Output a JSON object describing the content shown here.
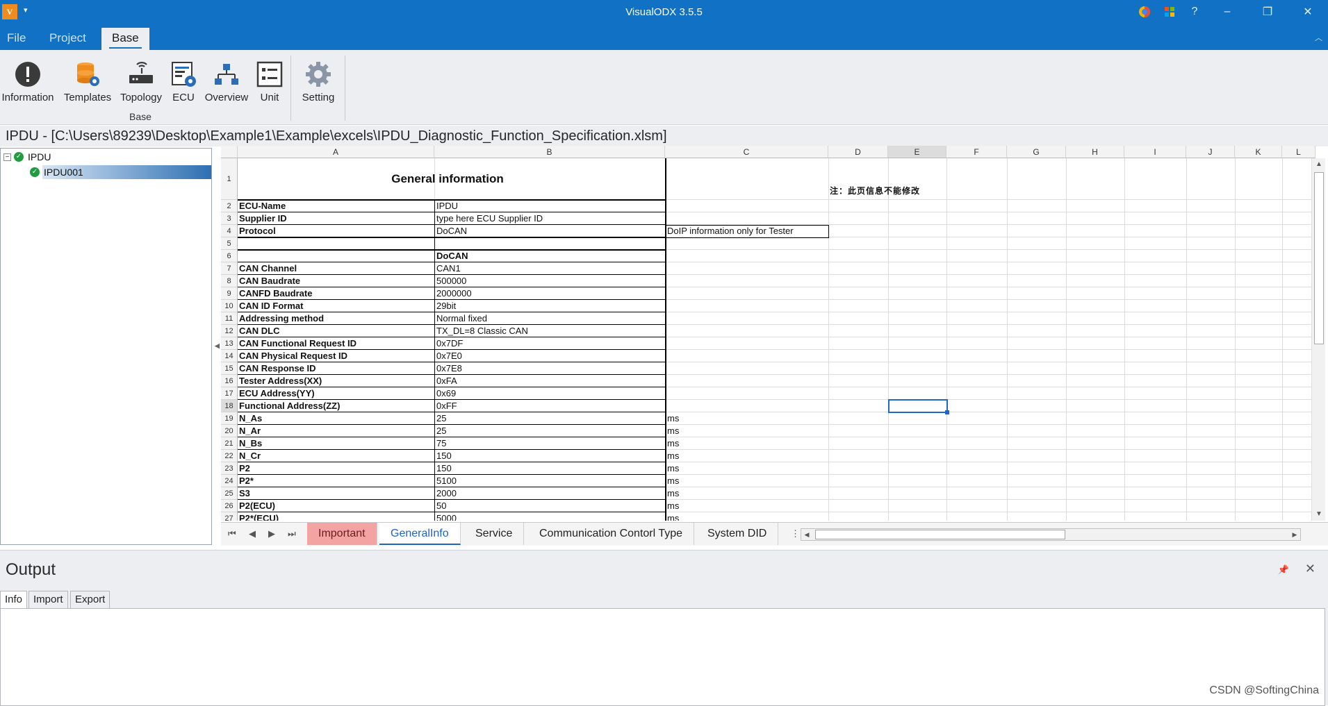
{
  "titlebar": {
    "title": "VisualODX 3.5.5",
    "app_icon_text": "V",
    "help_symbol": "?"
  },
  "menu": {
    "file": "File",
    "project": "Project",
    "base": "Base"
  },
  "ribbon": {
    "buttons": [
      "Information",
      "Templates",
      "Topology",
      "ECU",
      "Overview",
      "Unit",
      "Setting"
    ],
    "group_label": "Base"
  },
  "path": "IPDU - [C:\\Users\\89239\\Desktop\\Example1\\Example\\excels\\IPDU_Diagnostic_Function_Specification.xlsm]",
  "tree": {
    "root": "IPDU",
    "child": "IPDU001"
  },
  "sheet": {
    "columns": [
      "A",
      "B",
      "C",
      "D",
      "E",
      "F",
      "G",
      "H",
      "I",
      "J",
      "K",
      "L"
    ],
    "title": "General information",
    "note": "注：此页信息不能修改",
    "rows": [
      {
        "n": "1",
        "a": "",
        "b": "",
        "c": ""
      },
      {
        "n": "2",
        "a": "ECU-Name",
        "b": "IPDU",
        "c": ""
      },
      {
        "n": "3",
        "a": "Supplier ID",
        "b": "type here ECU Supplier ID",
        "c": ""
      },
      {
        "n": "4",
        "a": "Protocol",
        "b": "DoCAN",
        "c": "DoIP information only for Tester"
      },
      {
        "n": "5",
        "a": "",
        "b": "",
        "c": ""
      },
      {
        "n": "6",
        "a": "",
        "b": "DoCAN",
        "c": ""
      },
      {
        "n": "7",
        "a": "CAN Channel",
        "b": "CAN1",
        "c": ""
      },
      {
        "n": "8",
        "a": "CAN Baudrate",
        "b": "500000",
        "c": ""
      },
      {
        "n": "9",
        "a": "CANFD Baudrate",
        "b": "2000000",
        "c": ""
      },
      {
        "n": "10",
        "a": "CAN ID Format",
        "b": "29bit",
        "c": ""
      },
      {
        "n": "11",
        "a": "Addressing method",
        "b": "Normal fixed",
        "c": ""
      },
      {
        "n": "12",
        "a": "CAN DLC",
        "b": "TX_DL=8 Classic CAN",
        "c": ""
      },
      {
        "n": "13",
        "a": "CAN Functional Request ID",
        "b": "0x7DF",
        "c": ""
      },
      {
        "n": "14",
        "a": "CAN Physical Request ID",
        "b": "0x7E0",
        "c": ""
      },
      {
        "n": "15",
        "a": "CAN Response ID",
        "b": "0x7E8",
        "c": ""
      },
      {
        "n": "16",
        "a": "Tester Address(XX)",
        "b": "0xFA",
        "c": ""
      },
      {
        "n": "17",
        "a": "ECU Address(YY)",
        "b": "0x69",
        "c": ""
      },
      {
        "n": "18",
        "a": "Functional Address(ZZ)",
        "b": "0xFF",
        "c": ""
      },
      {
        "n": "19",
        "a": "N_As",
        "b": "25",
        "c": "ms"
      },
      {
        "n": "20",
        "a": "N_Ar",
        "b": "25",
        "c": "ms"
      },
      {
        "n": "21",
        "a": "N_Bs",
        "b": "75",
        "c": "ms"
      },
      {
        "n": "22",
        "a": "N_Cr",
        "b": "150",
        "c": "ms"
      },
      {
        "n": "23",
        "a": "P2",
        "b": "150",
        "c": "ms"
      },
      {
        "n": "24",
        "a": "P2*",
        "b": "5100",
        "c": "ms"
      },
      {
        "n": "25",
        "a": "S3",
        "b": "2000",
        "c": "ms"
      },
      {
        "n": "26",
        "a": "P2(ECU)",
        "b": "50",
        "c": "ms"
      },
      {
        "n": "27",
        "a": "P2*(ECU)",
        "b": "5000",
        "c": "ms"
      }
    ],
    "tabs": [
      "Important",
      "GeneralInfo",
      "Service",
      "Communication Contorl Type",
      "System DID"
    ],
    "nav": [
      "⏮",
      "◀",
      "▶",
      "⏭"
    ]
  },
  "output": {
    "title": "Output",
    "tabs": [
      "Info",
      "Import",
      "Export"
    ]
  },
  "watermark": "CSDN @SoftingChina"
}
